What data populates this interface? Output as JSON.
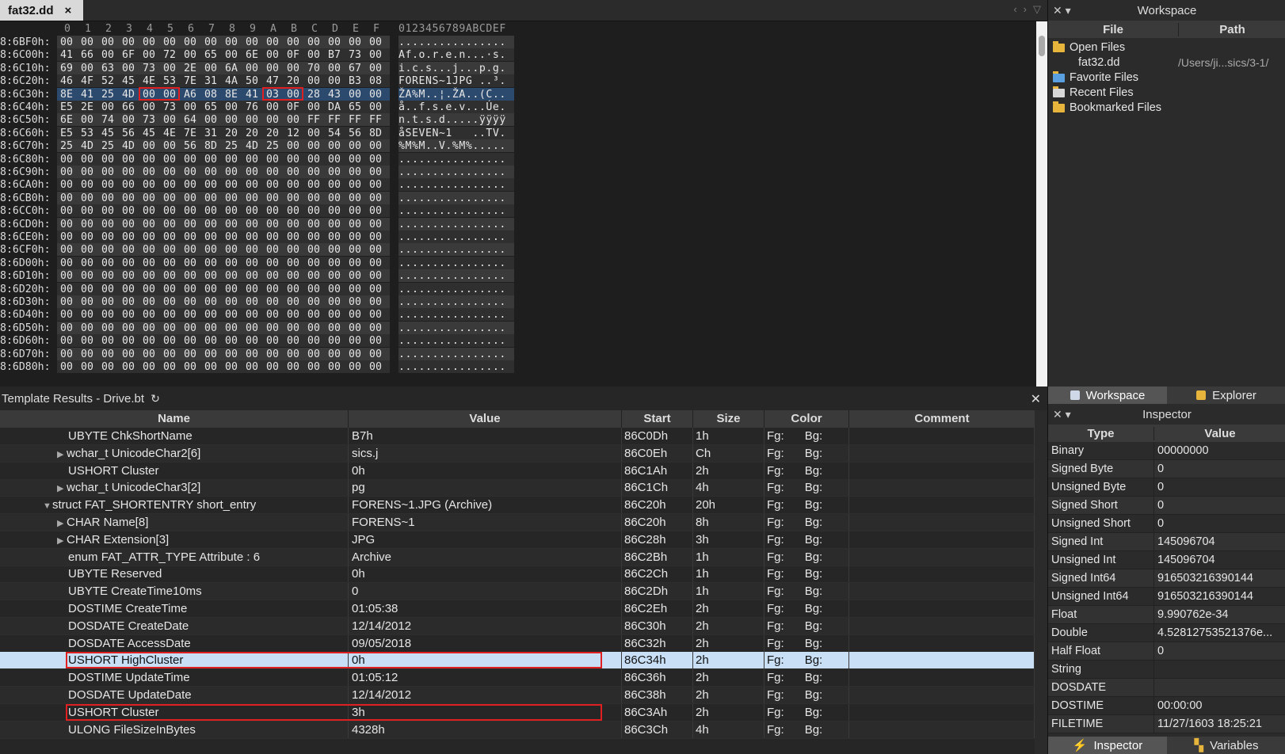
{
  "tab": {
    "title": "fat32.dd",
    "close": "×"
  },
  "hex": {
    "header_cols": [
      "0",
      "1",
      "2",
      "3",
      "4",
      "5",
      "6",
      "7",
      "8",
      "9",
      "A",
      "B",
      "C",
      "D",
      "E",
      "F"
    ],
    "header_ascii": "0123456789ABCDEF",
    "rows": [
      {
        "addr": "8:6BF0h:",
        "bytes": [
          "00",
          "00",
          "00",
          "00",
          "00",
          "00",
          "00",
          "00",
          "00",
          "00",
          "00",
          "00",
          "00",
          "00",
          "00",
          "00"
        ],
        "ascii": "................"
      },
      {
        "addr": "8:6C00h:",
        "bytes": [
          "41",
          "66",
          "00",
          "6F",
          "00",
          "72",
          "00",
          "65",
          "00",
          "6E",
          "00",
          "0F",
          "00",
          "B7",
          "73",
          "00"
        ],
        "ascii": "Af.o.r.e.n...·s."
      },
      {
        "addr": "8:6C10h:",
        "bytes": [
          "69",
          "00",
          "63",
          "00",
          "73",
          "00",
          "2E",
          "00",
          "6A",
          "00",
          "00",
          "00",
          "70",
          "00",
          "67",
          "00"
        ],
        "ascii": "i.c.s...j...p.g."
      },
      {
        "addr": "8:6C20h:",
        "bytes": [
          "46",
          "4F",
          "52",
          "45",
          "4E",
          "53",
          "7E",
          "31",
          "4A",
          "50",
          "47",
          "20",
          "00",
          "00",
          "B3",
          "08"
        ],
        "ascii": "FORENS~1JPG ..³."
      },
      {
        "addr": "8:6C30h:",
        "bytes": [
          "8E",
          "41",
          "25",
          "4D",
          "00",
          "00",
          "A6",
          "08",
          "8E",
          "41",
          "03",
          "00",
          "28",
          "43",
          "00",
          "00"
        ],
        "ascii": "ŽA%M..¦.ŽA..(C.."
      },
      {
        "addr": "8:6C40h:",
        "bytes": [
          "E5",
          "2E",
          "00",
          "66",
          "00",
          "73",
          "00",
          "65",
          "00",
          "76",
          "00",
          "0F",
          "00",
          "DA",
          "65",
          "00"
        ],
        "ascii": "å..f.s.e.v...Úe."
      },
      {
        "addr": "8:6C50h:",
        "bytes": [
          "6E",
          "00",
          "74",
          "00",
          "73",
          "00",
          "64",
          "00",
          "00",
          "00",
          "00",
          "00",
          "FF",
          "FF",
          "FF",
          "FF"
        ],
        "ascii": "n.t.s.d.....ÿÿÿÿ"
      },
      {
        "addr": "8:6C60h:",
        "bytes": [
          "E5",
          "53",
          "45",
          "56",
          "45",
          "4E",
          "7E",
          "31",
          "20",
          "20",
          "20",
          "12",
          "00",
          "54",
          "56",
          "8D"
        ],
        "ascii": "åSEVEN~1   ..TV."
      },
      {
        "addr": "8:6C70h:",
        "bytes": [
          "25",
          "4D",
          "25",
          "4D",
          "00",
          "00",
          "56",
          "8D",
          "25",
          "4D",
          "25",
          "00",
          "00",
          "00",
          "00",
          "00"
        ],
        "ascii": "%M%M..V.%M%....."
      },
      {
        "addr": "8:6C80h:",
        "bytes": [
          "00",
          "00",
          "00",
          "00",
          "00",
          "00",
          "00",
          "00",
          "00",
          "00",
          "00",
          "00",
          "00",
          "00",
          "00",
          "00"
        ],
        "ascii": "................"
      },
      {
        "addr": "8:6C90h:",
        "bytes": [
          "00",
          "00",
          "00",
          "00",
          "00",
          "00",
          "00",
          "00",
          "00",
          "00",
          "00",
          "00",
          "00",
          "00",
          "00",
          "00"
        ],
        "ascii": "................"
      },
      {
        "addr": "8:6CA0h:",
        "bytes": [
          "00",
          "00",
          "00",
          "00",
          "00",
          "00",
          "00",
          "00",
          "00",
          "00",
          "00",
          "00",
          "00",
          "00",
          "00",
          "00"
        ],
        "ascii": "................"
      },
      {
        "addr": "8:6CB0h:",
        "bytes": [
          "00",
          "00",
          "00",
          "00",
          "00",
          "00",
          "00",
          "00",
          "00",
          "00",
          "00",
          "00",
          "00",
          "00",
          "00",
          "00"
        ],
        "ascii": "................"
      },
      {
        "addr": "8:6CC0h:",
        "bytes": [
          "00",
          "00",
          "00",
          "00",
          "00",
          "00",
          "00",
          "00",
          "00",
          "00",
          "00",
          "00",
          "00",
          "00",
          "00",
          "00"
        ],
        "ascii": "................"
      },
      {
        "addr": "8:6CD0h:",
        "bytes": [
          "00",
          "00",
          "00",
          "00",
          "00",
          "00",
          "00",
          "00",
          "00",
          "00",
          "00",
          "00",
          "00",
          "00",
          "00",
          "00"
        ],
        "ascii": "................"
      },
      {
        "addr": "8:6CE0h:",
        "bytes": [
          "00",
          "00",
          "00",
          "00",
          "00",
          "00",
          "00",
          "00",
          "00",
          "00",
          "00",
          "00",
          "00",
          "00",
          "00",
          "00"
        ],
        "ascii": "................"
      },
      {
        "addr": "8:6CF0h:",
        "bytes": [
          "00",
          "00",
          "00",
          "00",
          "00",
          "00",
          "00",
          "00",
          "00",
          "00",
          "00",
          "00",
          "00",
          "00",
          "00",
          "00"
        ],
        "ascii": "................"
      },
      {
        "addr": "8:6D00h:",
        "bytes": [
          "00",
          "00",
          "00",
          "00",
          "00",
          "00",
          "00",
          "00",
          "00",
          "00",
          "00",
          "00",
          "00",
          "00",
          "00",
          "00"
        ],
        "ascii": "................"
      },
      {
        "addr": "8:6D10h:",
        "bytes": [
          "00",
          "00",
          "00",
          "00",
          "00",
          "00",
          "00",
          "00",
          "00",
          "00",
          "00",
          "00",
          "00",
          "00",
          "00",
          "00"
        ],
        "ascii": "................"
      },
      {
        "addr": "8:6D20h:",
        "bytes": [
          "00",
          "00",
          "00",
          "00",
          "00",
          "00",
          "00",
          "00",
          "00",
          "00",
          "00",
          "00",
          "00",
          "00",
          "00",
          "00"
        ],
        "ascii": "................"
      },
      {
        "addr": "8:6D30h:",
        "bytes": [
          "00",
          "00",
          "00",
          "00",
          "00",
          "00",
          "00",
          "00",
          "00",
          "00",
          "00",
          "00",
          "00",
          "00",
          "00",
          "00"
        ],
        "ascii": "................"
      },
      {
        "addr": "8:6D40h:",
        "bytes": [
          "00",
          "00",
          "00",
          "00",
          "00",
          "00",
          "00",
          "00",
          "00",
          "00",
          "00",
          "00",
          "00",
          "00",
          "00",
          "00"
        ],
        "ascii": "................"
      },
      {
        "addr": "8:6D50h:",
        "bytes": [
          "00",
          "00",
          "00",
          "00",
          "00",
          "00",
          "00",
          "00",
          "00",
          "00",
          "00",
          "00",
          "00",
          "00",
          "00",
          "00"
        ],
        "ascii": "................"
      },
      {
        "addr": "8:6D60h:",
        "bytes": [
          "00",
          "00",
          "00",
          "00",
          "00",
          "00",
          "00",
          "00",
          "00",
          "00",
          "00",
          "00",
          "00",
          "00",
          "00",
          "00"
        ],
        "ascii": "................"
      },
      {
        "addr": "8:6D70h:",
        "bytes": [
          "00",
          "00",
          "00",
          "00",
          "00",
          "00",
          "00",
          "00",
          "00",
          "00",
          "00",
          "00",
          "00",
          "00",
          "00",
          "00"
        ],
        "ascii": "................"
      },
      {
        "addr": "8:6D80h:",
        "bytes": [
          "00",
          "00",
          "00",
          "00",
          "00",
          "00",
          "00",
          "00",
          "00",
          "00",
          "00",
          "00",
          "00",
          "00",
          "00",
          "00"
        ],
        "ascii": "................"
      }
    ]
  },
  "workspace": {
    "title": "Workspace",
    "columns": [
      "File",
      "Path"
    ],
    "items": [
      {
        "label": "Open Files",
        "path": "",
        "icon": "folder-open-icon"
      },
      {
        "label": "fat32.dd",
        "path": "/Users/ji...sics/3-1/",
        "icon": ""
      },
      {
        "label": "Favorite Files",
        "path": "",
        "icon": "favorites-icon"
      },
      {
        "label": "Recent Files",
        "path": "",
        "icon": "recent-icon"
      },
      {
        "label": "Bookmarked Files",
        "path": "",
        "icon": "bookmark-icon"
      }
    ]
  },
  "template": {
    "title": "Template Results - Drive.bt",
    "columns": [
      "Name",
      "Value",
      "Start",
      "Size",
      "Color",
      "Comment"
    ],
    "rows": [
      {
        "name": "UBYTE ChkShortName",
        "value": "B7h",
        "start": "86C0Dh",
        "size": "1h",
        "fg": "Fg:",
        "bg": "Bg:",
        "indent": 2,
        "tri": ""
      },
      {
        "name": "wchar_t UnicodeChar2[6]",
        "value": "sics.j",
        "start": "86C0Eh",
        "size": "Ch",
        "fg": "Fg:",
        "bg": "Bg:",
        "indent": 1,
        "tri": "▶"
      },
      {
        "name": "USHORT Cluster",
        "value": "0h",
        "start": "86C1Ah",
        "size": "2h",
        "fg": "Fg:",
        "bg": "Bg:",
        "indent": 2,
        "tri": ""
      },
      {
        "name": "wchar_t UnicodeChar3[2]",
        "value": "pg",
        "start": "86C1Ch",
        "size": "4h",
        "fg": "Fg:",
        "bg": "Bg:",
        "indent": 1,
        "tri": "▶"
      },
      {
        "name": "struct FAT_SHORTENTRY short_entry",
        "value": "FORENS~1.JPG (Archive)",
        "start": "86C20h",
        "size": "20h",
        "fg": "Fg:",
        "bg": "Bg:",
        "indent": 0,
        "tri": "▼"
      },
      {
        "name": "CHAR Name[8]",
        "value": "FORENS~1",
        "start": "86C20h",
        "size": "8h",
        "fg": "Fg:",
        "bg": "Bg:",
        "indent": 1,
        "tri": "▶"
      },
      {
        "name": "CHAR Extension[3]",
        "value": "JPG",
        "start": "86C28h",
        "size": "3h",
        "fg": "Fg:",
        "bg": "Bg:",
        "indent": 1,
        "tri": "▶"
      },
      {
        "name": "enum FAT_ATTR_TYPE Attribute : 6",
        "value": "Archive",
        "start": "86C2Bh",
        "size": "1h",
        "fg": "Fg:",
        "bg": "Bg:",
        "indent": 2,
        "tri": ""
      },
      {
        "name": "UBYTE Reserved",
        "value": "0h",
        "start": "86C2Ch",
        "size": "1h",
        "fg": "Fg:",
        "bg": "Bg:",
        "indent": 2,
        "tri": ""
      },
      {
        "name": "UBYTE CreateTime10ms",
        "value": "0",
        "start": "86C2Dh",
        "size": "1h",
        "fg": "Fg:",
        "bg": "Bg:",
        "indent": 2,
        "tri": ""
      },
      {
        "name": "DOSTIME CreateTime",
        "value": "01:05:38",
        "start": "86C2Eh",
        "size": "2h",
        "fg": "Fg:",
        "bg": "Bg:",
        "indent": 2,
        "tri": ""
      },
      {
        "name": "DOSDATE CreateDate",
        "value": "12/14/2012",
        "start": "86C30h",
        "size": "2h",
        "fg": "Fg:",
        "bg": "Bg:",
        "indent": 2,
        "tri": ""
      },
      {
        "name": "DOSDATE AccessDate",
        "value": "09/05/2018",
        "start": "86C32h",
        "size": "2h",
        "fg": "Fg:",
        "bg": "Bg:",
        "indent": 2,
        "tri": ""
      },
      {
        "name": "USHORT HighCluster",
        "value": "0h",
        "start": "86C34h",
        "size": "2h",
        "fg": "Fg:",
        "bg": "Bg:",
        "indent": 2,
        "tri": "",
        "selected": true,
        "boxed": true
      },
      {
        "name": "DOSTIME UpdateTime",
        "value": "01:05:12",
        "start": "86C36h",
        "size": "2h",
        "fg": "Fg:",
        "bg": "Bg:",
        "indent": 2,
        "tri": ""
      },
      {
        "name": "DOSDATE UpdateDate",
        "value": "12/14/2012",
        "start": "86C38h",
        "size": "2h",
        "fg": "Fg:",
        "bg": "Bg:",
        "indent": 2,
        "tri": ""
      },
      {
        "name": "USHORT Cluster",
        "value": "3h",
        "start": "86C3Ah",
        "size": "2h",
        "fg": "Fg:",
        "bg": "Bg:",
        "indent": 2,
        "tri": "",
        "boxed": true
      },
      {
        "name": "ULONG FileSizeInBytes",
        "value": "4328h",
        "start": "86C3Ch",
        "size": "4h",
        "fg": "Fg:",
        "bg": "Bg:",
        "indent": 2,
        "tri": ""
      }
    ]
  },
  "lower_tabs": {
    "workspace": "Workspace",
    "explorer": "Explorer"
  },
  "inspector": {
    "title": "Inspector",
    "columns": [
      "Type",
      "Value"
    ],
    "rows": [
      {
        "type": "Binary",
        "value": "00000000"
      },
      {
        "type": "Signed Byte",
        "value": "0"
      },
      {
        "type": "Unsigned Byte",
        "value": "0"
      },
      {
        "type": "Signed Short",
        "value": "0"
      },
      {
        "type": "Unsigned Short",
        "value": "0"
      },
      {
        "type": "Signed Int",
        "value": "145096704"
      },
      {
        "type": "Unsigned Int",
        "value": "145096704"
      },
      {
        "type": "Signed Int64",
        "value": "916503216390144"
      },
      {
        "type": "Unsigned Int64",
        "value": "916503216390144"
      },
      {
        "type": "Float",
        "value": "9.990762e-34"
      },
      {
        "type": "Double",
        "value": "4.52812753521376e..."
      },
      {
        "type": "Half Float",
        "value": "0"
      },
      {
        "type": "String",
        "value": ""
      },
      {
        "type": "DOSDATE",
        "value": ""
      },
      {
        "type": "DOSTIME",
        "value": "00:00:00"
      },
      {
        "type": "FILETIME",
        "value": "11/27/1603 18:25:21"
      }
    ],
    "bottom_tabs": {
      "inspector": "Inspector",
      "variables": "Variables"
    }
  }
}
